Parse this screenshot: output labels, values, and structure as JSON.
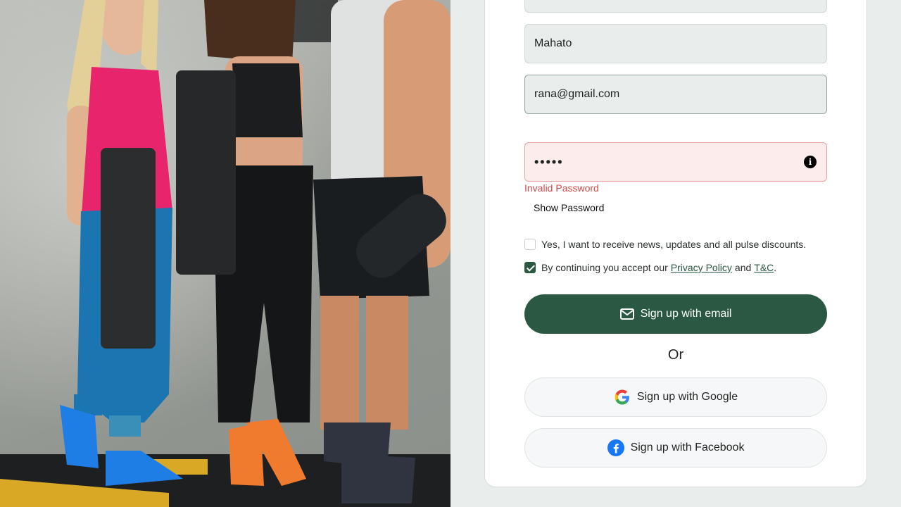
{
  "form": {
    "top_field_value": "",
    "last_name_value": "Mahato",
    "email_value": "rana@gmail.com",
    "password_mask": "•••••",
    "password_error": "Invalid Password",
    "show_password_label": "Show Password",
    "newsletter_label": "Yes, I want to receive news, updates and all pulse discounts.",
    "newsletter_checked": false,
    "terms_prefix": "By continuing you accept our",
    "privacy_link": "Privacy Policy",
    "terms_and": "and",
    "tc_link": "T&C",
    "terms_suffix": ".",
    "terms_checked": true
  },
  "buttons": {
    "email_signup": "Sign up with email",
    "or_label": "Or",
    "google_signup": "Sign up with Google",
    "facebook_signup": "Sign up with Facebook"
  },
  "icons": {
    "email": "envelope-icon",
    "google": "google-icon",
    "facebook": "facebook-icon",
    "password_info": "info-icon"
  },
  "colors": {
    "primary": "#2a5842",
    "error": "#d04a4a",
    "error_bg": "#fdecec",
    "field_bg": "#e9edeb",
    "page_bg": "#e9edeb"
  }
}
